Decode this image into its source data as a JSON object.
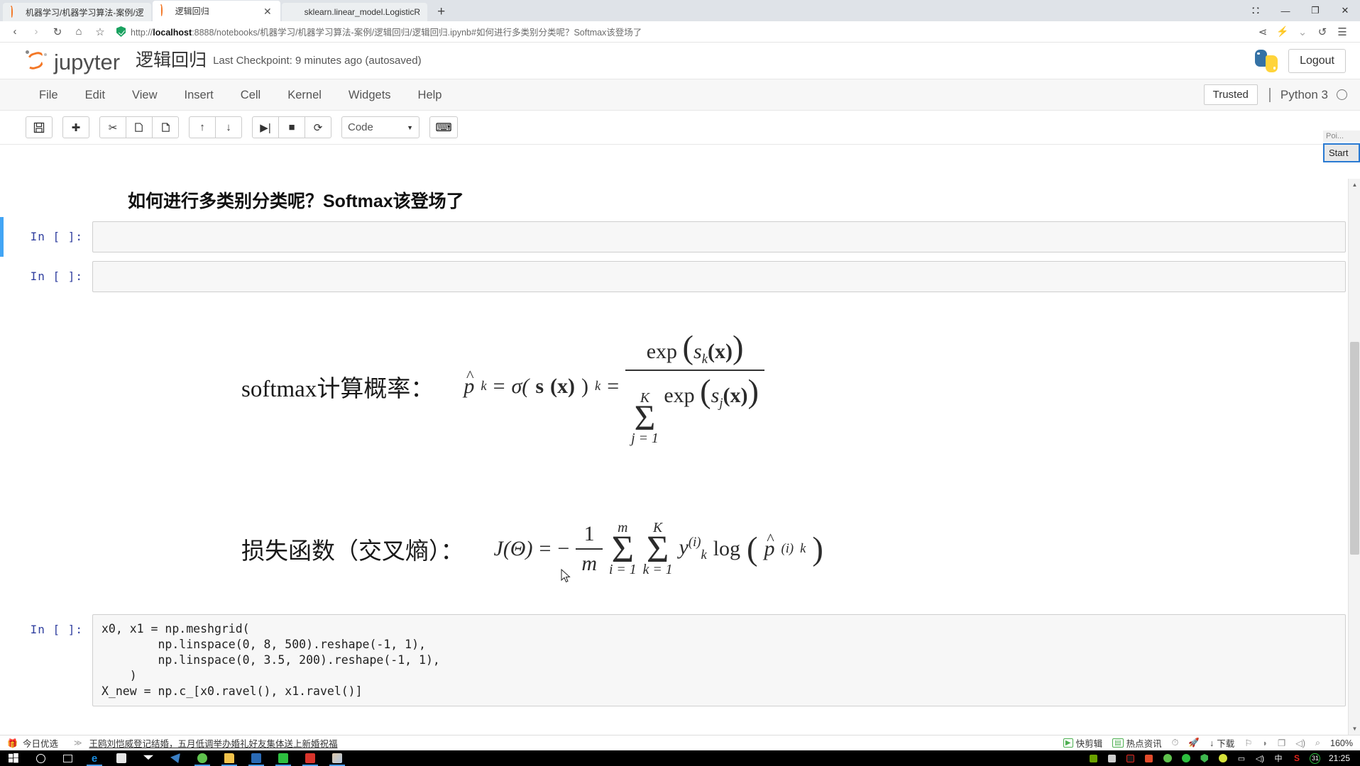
{
  "browser": {
    "tabs": [
      {
        "title": "机器学习/机器学习算法-案例/逻",
        "icon": "jupyter-icon",
        "active": false
      },
      {
        "title": "逻辑回归",
        "icon": "jupyter-icon",
        "active": true,
        "close": "✕"
      },
      {
        "title": "sklearn.linear_model.LogisticR",
        "icon": "sklearn-icon",
        "active": false
      }
    ],
    "new_tab_label": "+",
    "window_controls": [
      "⛚",
      "—",
      "❐",
      "✕"
    ],
    "nav": {
      "back": "‹",
      "forward": "›",
      "reload": "↻",
      "home": "⌂",
      "bookmark": "☆",
      "share": "⋖",
      "bolt": "⚡",
      "chevron": "⌄",
      "history": "↺",
      "menu": "☰"
    },
    "url": {
      "scheme": "http://",
      "host": "localhost",
      "rest": ":8888/notebooks/机器学习/机器学习算法-案例/逻辑回归/逻辑回归.ipynb#如何进行多类别分类呢？Softmax该登场了",
      "full": "http://localhost:8888/notebooks/机器学习/机器学习算法-案例/逻辑回归/逻辑回归.ipynb#如何进行多类别分类呢？Softmax该登场了"
    }
  },
  "jupyter": {
    "brand": "jupyter",
    "notebook_name": "逻辑回归",
    "checkpoint": "Last Checkpoint: 9 minutes ago (autosaved)",
    "logout": "Logout",
    "menu": [
      "File",
      "Edit",
      "View",
      "Insert",
      "Cell",
      "Kernel",
      "Widgets",
      "Help"
    ],
    "trusted": "Trusted",
    "kernel": "Python 3",
    "toolbar": {
      "save": "💾",
      "insert": "✚",
      "cut": "✂",
      "copy": "⧉",
      "paste": "📋",
      "move_up": "↑",
      "move_down": "↓",
      "run": "▶|",
      "stop": "■",
      "restart": "⟳",
      "cell_type": "Code",
      "caret": "▼",
      "keyboard": "⌨"
    }
  },
  "notebook": {
    "heading": "如何进行多类别分类呢？Softmax该登场了",
    "cells": [
      {
        "prompt": "In [ ]:",
        "source": "",
        "selected": true
      },
      {
        "prompt": "In [ ]:",
        "source": "",
        "selected": false
      },
      {
        "prompt": "In [ ]:",
        "source": "x0, x1 = np.meshgrid(\n        np.linspace(0, 8, 500).reshape(-1, 1),\n        np.linspace(0, 3.5, 200).reshape(-1, 1),\n    )\nX_new = np.c_[x0.ravel(), x1.ravel()]",
        "selected": false
      }
    ],
    "formulas": [
      {
        "label": "softmax计算概率：",
        "latex": "\\hat{p}_k = \\sigma(\\mathbf{s}(\\mathbf{x}))_k = \\frac{\\exp(s_k(\\mathbf{x}))}{\\sum_{j=1}^{K} \\exp(s_j(\\mathbf{x}))}",
        "parts": {
          "lhs_p": "p",
          "lhs_sub": "k",
          "eq1": "=",
          "sigma_fn": "σ(",
          "s_bold": "s",
          "x_bold": "(x)",
          "close": ")",
          "sub_k": "k",
          "eq2": "=",
          "num_exp": "exp",
          "num_s": "s",
          "num_sub": "k",
          "num_x": "(x)",
          "den_sum_top": "K",
          "den_sum_bot": "j = 1",
          "den_exp": "exp",
          "den_s": "s",
          "den_sub": "j",
          "den_x": "(x)"
        }
      },
      {
        "label": "损失函数（交叉熵）：",
        "latex": "J(\\Theta) = -\\frac{1}{m}\\sum_{i=1}^{m}\\sum_{k=1}^{K} y_k^{(i)} \\log\\left(\\hat{p}_k^{(i)}\\right)",
        "parts": {
          "J": "J(Θ)",
          "eq": "=",
          "minus": "−",
          "frac_num": "1",
          "frac_den": "m",
          "sum1_top": "m",
          "sum1_bot": "i = 1",
          "sum2_top": "K",
          "sum2_bot": "k = 1",
          "y": "y",
          "y_sub": "k",
          "y_sup": "(i)",
          "log": "log",
          "p": "p",
          "p_sub": "k",
          "p_sup": "(i)"
        }
      }
    ]
  },
  "popup": {
    "title": "Poi...",
    "button": "Start"
  },
  "adstrip": {
    "gift_icon": "gift-icon",
    "label": "今日优选",
    "chevron": "≫",
    "news": "王鸥刘恺威登记结婚，五月低调举办婚礼好友集体送上新婚祝福",
    "right_items": [
      {
        "icon": "clip-icon",
        "label": "快剪辑"
      },
      {
        "icon": "news-icon",
        "label": "热点资讯"
      },
      {
        "icon": "speed-icon",
        "label": ""
      },
      {
        "icon": "rocket-icon",
        "label": ""
      },
      {
        "icon": "download-icon",
        "label": "下载"
      },
      {
        "icon": "flag-icon",
        "label": ""
      },
      {
        "icon": "shield-icon",
        "label": ""
      },
      {
        "icon": "window-icon",
        "label": ""
      },
      {
        "icon": "volume-icon",
        "label": ""
      },
      {
        "icon": "search-icon",
        "label": ""
      },
      {
        "icon": "zoom-level",
        "label": "160%"
      }
    ]
  },
  "taskbar": {
    "left_icons": [
      "start-icon",
      "cortana-icon",
      "taskview-icon",
      "edge-icon",
      "store-icon",
      "mail-icon",
      "bird-icon",
      "browser360-icon",
      "explorer-icon",
      "news-icon",
      "wechat-icon",
      "pycharm-icon",
      "paint-icon"
    ],
    "tray_icons": [
      "nvidia-icon",
      "note-icon",
      "acrobat-icon",
      "coffee-icon",
      "360-icon",
      "wechat-tray-icon",
      "shield-tray-icon",
      "sogou-icon",
      "display-icon",
      "volume-icon"
    ],
    "ime": "中",
    "sogou": "S",
    "calendar_day": "31",
    "clock": "21:25"
  }
}
